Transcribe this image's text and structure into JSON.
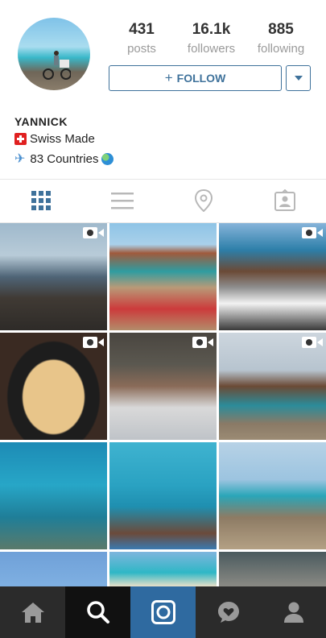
{
  "profile": {
    "username": "YANNICK",
    "bio_line1": "Swiss Made",
    "bio_line2": "83 Countries"
  },
  "stats": {
    "posts": {
      "value": "431",
      "label": "posts"
    },
    "followers": {
      "value": "16.1k",
      "label": "followers"
    },
    "following": {
      "value": "885",
      "label": "following"
    }
  },
  "actions": {
    "follow_label": "FOLLOW"
  },
  "tabs": [
    "grid-view",
    "list-view",
    "location-view",
    "tagged-view"
  ],
  "colors": {
    "accent": "#3f729b",
    "tab_active": "#3f729b",
    "tab_inactive": "#b8b8b8",
    "nav_bg": "#2b2b2b",
    "nav_active_search": "#111111",
    "nav_active_camera": "#2f6aa0"
  },
  "posts_grid": [
    {
      "type": "video",
      "scene": "ocean-deck"
    },
    {
      "type": "photo",
      "scene": "overwater-villas-walkway"
    },
    {
      "type": "video",
      "scene": "man-on-cargo-bike"
    },
    {
      "type": "video",
      "scene": "crepe-on-griddle"
    },
    {
      "type": "video",
      "scene": "man-on-bed"
    },
    {
      "type": "video",
      "scene": "lagoon-pavilion"
    },
    {
      "type": "photo",
      "scene": "snorkeling-reef"
    },
    {
      "type": "photo",
      "scene": "man-on-water-steps"
    },
    {
      "type": "photo",
      "scene": "man-on-bike-jetty"
    },
    {
      "type": "photo",
      "scene": "sky"
    },
    {
      "type": "photo",
      "scene": "aerial-island"
    },
    {
      "type": "photo",
      "scene": "rock"
    }
  ],
  "bottom_nav": [
    "home",
    "search",
    "camera",
    "activity",
    "profile"
  ]
}
